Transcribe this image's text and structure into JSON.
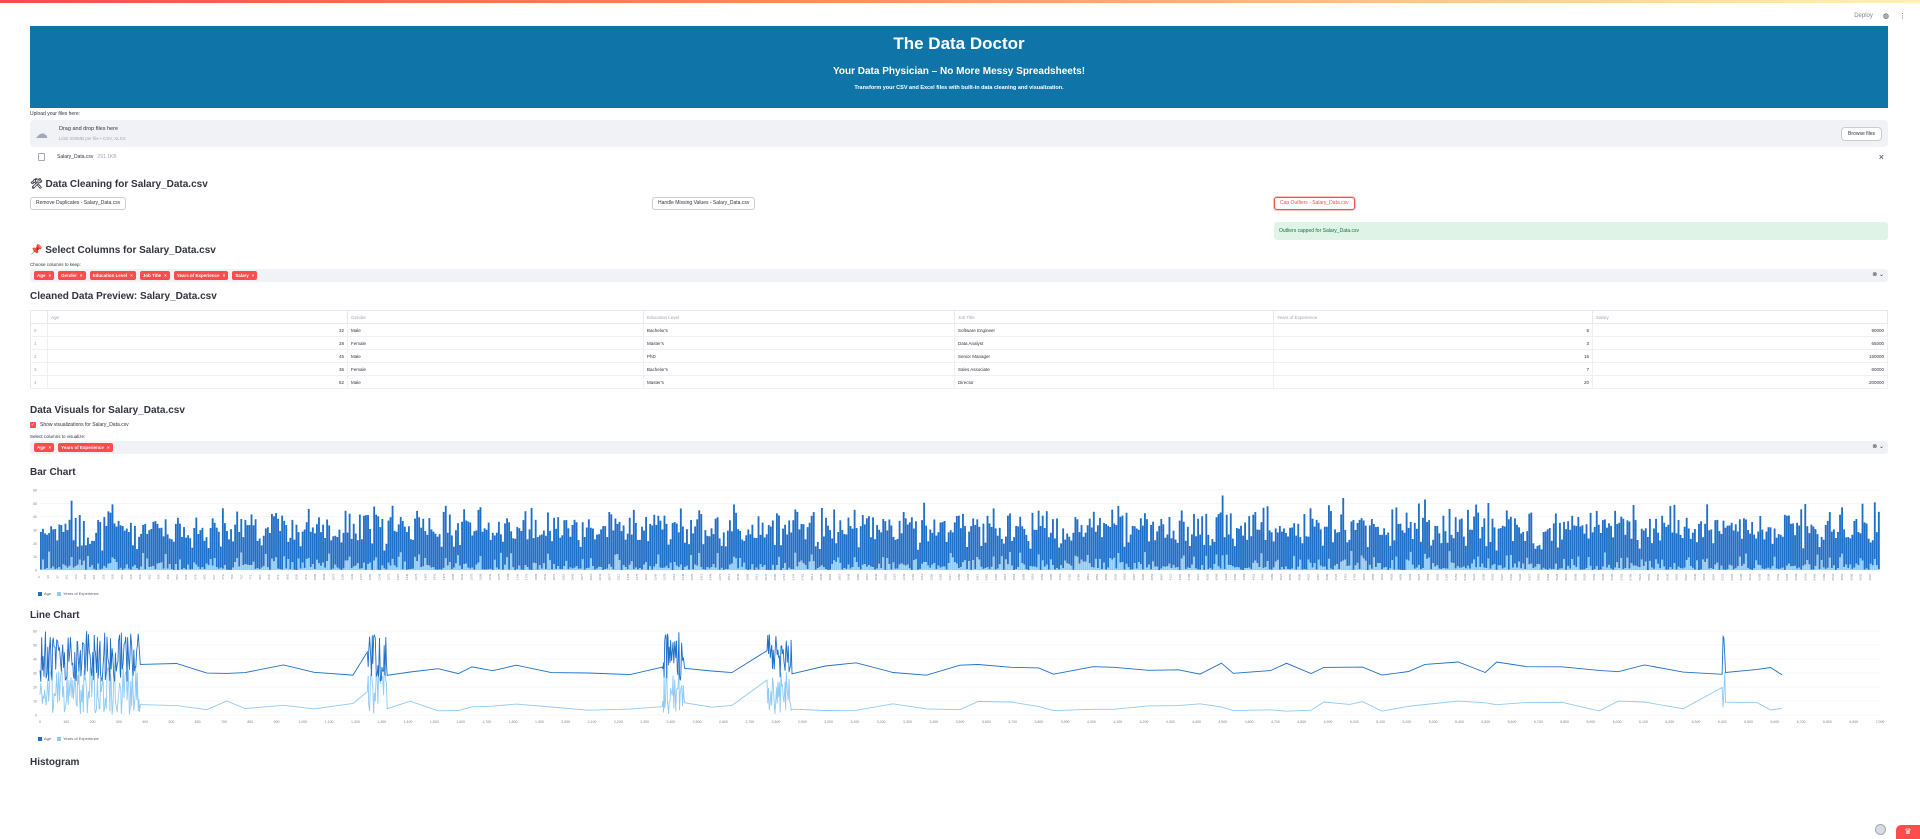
{
  "topbar": {
    "deploy_label": "Deploy"
  },
  "banner": {
    "title": "The Data Doctor",
    "subtitle": "Your Data Physician – No More Messy Spreadsheets!",
    "tagline": "Transform your CSV and Excel files with built-in data cleaning and visualization."
  },
  "upload": {
    "label": "Upload your files here:",
    "dropzone_title": "Drag and drop files here",
    "dropzone_sub": "Limit 200MB per file • CSV, XLSX",
    "browse_label": "Browse files",
    "file_name": "Salary_Data.csv",
    "file_size": "291.1KB"
  },
  "cleaning": {
    "title": "🛠 Data Cleaning for Salary_Data.csv",
    "btn_duplicates": "Remove Duplicates - Salary_Data.csv",
    "btn_missing": "Handle Missing Values - Salary_Data.csv",
    "btn_outliers": "Cap Outliers - Salary_Data.csv",
    "success_msg": "Outliers capped for Salary_Data.csv"
  },
  "select_columns": {
    "title": "📌 Select Columns for Salary_Data.csv",
    "label": "Choose columns to keep:",
    "tags": [
      "Age",
      "Gender",
      "Education Level",
      "Job Title",
      "Years of Experience",
      "Salary"
    ]
  },
  "preview": {
    "title": "Cleaned Data Preview: Salary_Data.csv",
    "columns": [
      "",
      "Age",
      "Gender",
      "Education Level",
      "Job Title",
      "Years of Experience",
      "Salary"
    ],
    "rows": [
      [
        "0",
        "32",
        "Male",
        "Bachelor's",
        "Software Engineer",
        "5",
        "90000"
      ],
      [
        "1",
        "28",
        "Female",
        "Master's",
        "Data Analyst",
        "3",
        "65000"
      ],
      [
        "2",
        "45",
        "Male",
        "PhD",
        "Senior Manager",
        "15",
        "150000"
      ],
      [
        "3",
        "36",
        "Female",
        "Bachelor's",
        "Sales Associate",
        "7",
        "60000"
      ],
      [
        "4",
        "52",
        "Male",
        "Master's",
        "Director",
        "20",
        "200000"
      ]
    ]
  },
  "visuals": {
    "title": "Data Visuals for Salary_Data.csv",
    "checkbox_label": "Show visualizations for Salary_Data.csv",
    "select_label": "Select columns to visualize:",
    "tags": [
      "Age",
      "Years of Experience"
    ]
  },
  "bar_chart": {
    "title": "Bar Chart"
  },
  "line_chart": {
    "title": "Line Chart"
  },
  "histogram": {
    "title": "Histogram"
  },
  "colors": {
    "accent": "#ff4b4b",
    "banner": "#0f74a8",
    "series_age": "#1f6fc9",
    "series_exp": "#8fcaf5"
  },
  "chart_data": [
    {
      "type": "bar",
      "title": "Bar Chart",
      "x_range": [
        0,
        6700
      ],
      "ylim": [
        0,
        60
      ],
      "yticks": [
        0,
        10,
        20,
        30,
        40,
        50,
        60
      ],
      "series": [
        {
          "name": "Age",
          "typical_range": [
            23,
            62
          ]
        },
        {
          "name": "Years of Experience",
          "typical_range": [
            0,
            34
          ]
        }
      ],
      "stacked": true,
      "legend": "bottom-left"
    },
    {
      "type": "line",
      "title": "Line Chart",
      "xlim": [
        0,
        7000
      ],
      "xticks": [
        "0",
        "100",
        "200",
        "300",
        "400",
        "500",
        "600",
        "700",
        "800",
        "900",
        "1,000",
        "1,100",
        "1,200",
        "1,300",
        "1,400",
        "1,500",
        "1,600",
        "1,700",
        "1,800",
        "1,900",
        "2,000",
        "2,100",
        "2,200",
        "2,300",
        "2,400",
        "2,500",
        "2,600",
        "2,700",
        "2,800",
        "2,900",
        "3,000",
        "3,100",
        "3,200",
        "3,300",
        "3,400",
        "3,500",
        "3,600",
        "3,700",
        "3,800",
        "3,900",
        "4,000",
        "4,100",
        "4,200",
        "4,300",
        "4,400",
        "4,500",
        "4,600",
        "4,700",
        "4,800",
        "4,900",
        "5,000",
        "5,100",
        "5,200",
        "5,300",
        "5,400",
        "5,500",
        "5,600",
        "5,700",
        "5,800",
        "5,900",
        "6,000",
        "6,100",
        "6,200",
        "6,300",
        "6,400",
        "6,500",
        "6,600",
        "6,700",
        "6,800",
        "6,900",
        "7,000"
      ],
      "ylim": [
        0,
        60
      ],
      "yticks": [
        0,
        10,
        20,
        30,
        40,
        50,
        60
      ],
      "series": [
        {
          "name": "Age",
          "range": [
            23,
            60
          ]
        },
        {
          "name": "Years of Experience",
          "range": [
            0,
            34
          ]
        }
      ],
      "data_ends_at_x": 6700,
      "legend": "bottom-left"
    }
  ]
}
